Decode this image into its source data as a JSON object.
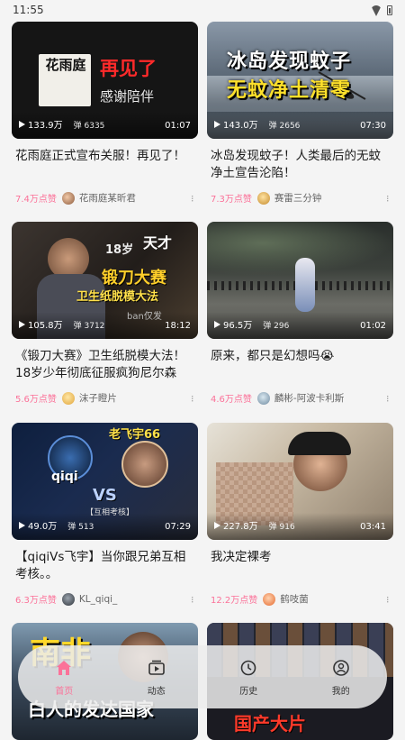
{
  "status_bar": {
    "time": "11:55"
  },
  "videos": [
    {
      "id": "v1",
      "views": "133.9万",
      "danmu": "弹 6335",
      "duration": "01:07",
      "title": "花雨庭正式宣布关服！再见了！",
      "likes": "7.4万点赞",
      "author": "花雨庭某昕君",
      "thumb_text": {
        "logo": "花雨庭",
        "main": "再见了",
        "sub": "感谢陪伴"
      }
    },
    {
      "id": "v2",
      "views": "143.0万",
      "danmu": "弹 2656",
      "duration": "07:30",
      "title": "冰岛发现蚊子！人类最后的无蚊净土宣告沦陷！",
      "likes": "7.3万点赞",
      "author": "赛雷三分钟",
      "thumb_text": {
        "line1": "冰岛发现蚊子",
        "line2": "无蚊净土清零"
      }
    },
    {
      "id": "v3",
      "views": "105.8万",
      "danmu": "弹 3712",
      "duration": "18:12",
      "title": "《锻刀大赛》卫生纸脱模大法！18岁少年彻底征服疯狗尼尔森",
      "likes": "5.6万点赞",
      "author": "沫子瞪片",
      "thumb_text": {
        "age": "18岁",
        "genius": "天才",
        "main": "锻刀大赛",
        "sub": "卫生纸脱模大法",
        "corner": "ban仅发"
      }
    },
    {
      "id": "v4",
      "views": "96.5万",
      "danmu": "弹 296",
      "duration": "01:02",
      "title": "原来，都只是幻想吗😭",
      "likes": "4.6万点赞",
      "author": "麟彬-阿波卡利斯"
    },
    {
      "id": "v5",
      "views": "49.0万",
      "danmu": "弹 513",
      "duration": "07:29",
      "title": "【qiqiVs飞宇】当你跟兄弟互相考核。。",
      "likes": "6.3万点赞",
      "author": "KL_qiqi_",
      "thumb_text": {
        "right": "老飞宇66",
        "left": "qiqi",
        "vs": "VS",
        "tag": "【互相考核】"
      }
    },
    {
      "id": "v6",
      "views": "227.8万",
      "danmu": "弹 916",
      "duration": "03:41",
      "title": "我决定裸考",
      "likes": "12.2万点赞",
      "author": "鹤吱菌"
    },
    {
      "id": "v7",
      "thumb_text": {
        "main": "南非",
        "sub": "白人的发达国家"
      }
    },
    {
      "id": "v8",
      "thumb_text": {
        "bottom": "国产大片"
      }
    }
  ],
  "tabbar": {
    "items": [
      {
        "label": "首页",
        "icon": "home-icon",
        "active": true
      },
      {
        "label": "动态",
        "icon": "feed-icon",
        "active": false
      },
      {
        "label": "历史",
        "icon": "history-icon",
        "active": false
      },
      {
        "label": "我的",
        "icon": "profile-icon",
        "active": false
      }
    ]
  },
  "colors": {
    "accent": "#fb7299",
    "background": "#f4f4f4"
  }
}
